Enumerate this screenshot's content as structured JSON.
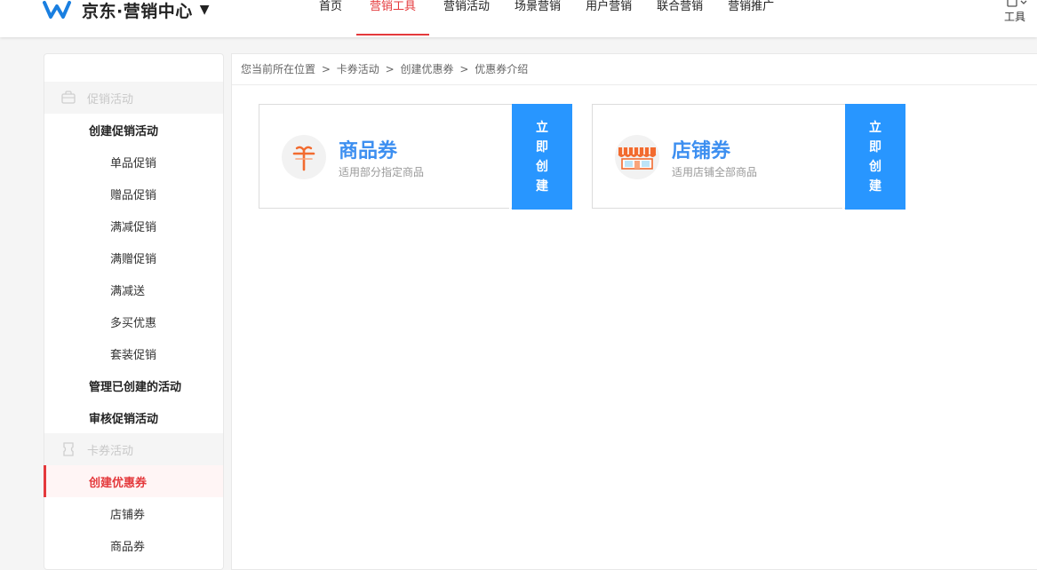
{
  "header": {
    "logo_text": "京东·营销中心",
    "logo_caret": "▼",
    "nav": [
      {
        "label": "首页",
        "active": false
      },
      {
        "label": "营销工具",
        "active": true
      },
      {
        "label": "营销活动",
        "active": false
      },
      {
        "label": "场景营销",
        "active": false
      },
      {
        "label": "用户营销",
        "active": false
      },
      {
        "label": "联合营销",
        "active": false
      },
      {
        "label": "营销推广",
        "active": false
      }
    ],
    "tools_label": "工具",
    "accent_color": "#e4393c"
  },
  "sidebar": {
    "groups": [
      {
        "label": "促销活动",
        "icon": "bag-icon",
        "items": [
          {
            "label": "创建促销活动",
            "level": 1
          },
          {
            "label": "单品促销",
            "level": 2
          },
          {
            "label": "赠品促销",
            "level": 2
          },
          {
            "label": "满减促销",
            "level": 2
          },
          {
            "label": "满赠促销",
            "level": 2
          },
          {
            "label": "满减送",
            "level": 2
          },
          {
            "label": "多买优惠",
            "level": 2
          },
          {
            "label": "套装促销",
            "level": 2
          },
          {
            "label": "管理已创建的活动",
            "level": 1
          },
          {
            "label": "审核促销活动",
            "level": 1
          }
        ]
      },
      {
        "label": "卡券活动",
        "icon": "ticket-icon",
        "items": [
          {
            "label": "创建优惠券",
            "level": 1,
            "active": true
          },
          {
            "label": "店铺券",
            "level": 2
          },
          {
            "label": "商品券",
            "level": 2
          }
        ]
      }
    ]
  },
  "breadcrumb": {
    "prefix": "您当前所在位置",
    "items": [
      "卡券活动",
      "创建优惠券",
      "优惠券介绍"
    ],
    "separator": ">"
  },
  "coupons": [
    {
      "title": "商品券",
      "desc": "适用部分指定商品",
      "button": [
        "立",
        "即",
        "创",
        "建"
      ],
      "icon": "gift-icon"
    },
    {
      "title": "店铺券",
      "desc": "适用店铺全部商品",
      "button": [
        "立",
        "即",
        "创",
        "建"
      ],
      "icon": "shop-icon"
    }
  ],
  "colors": {
    "button_blue": "#2896ff",
    "title_blue": "#3d8ff0"
  }
}
